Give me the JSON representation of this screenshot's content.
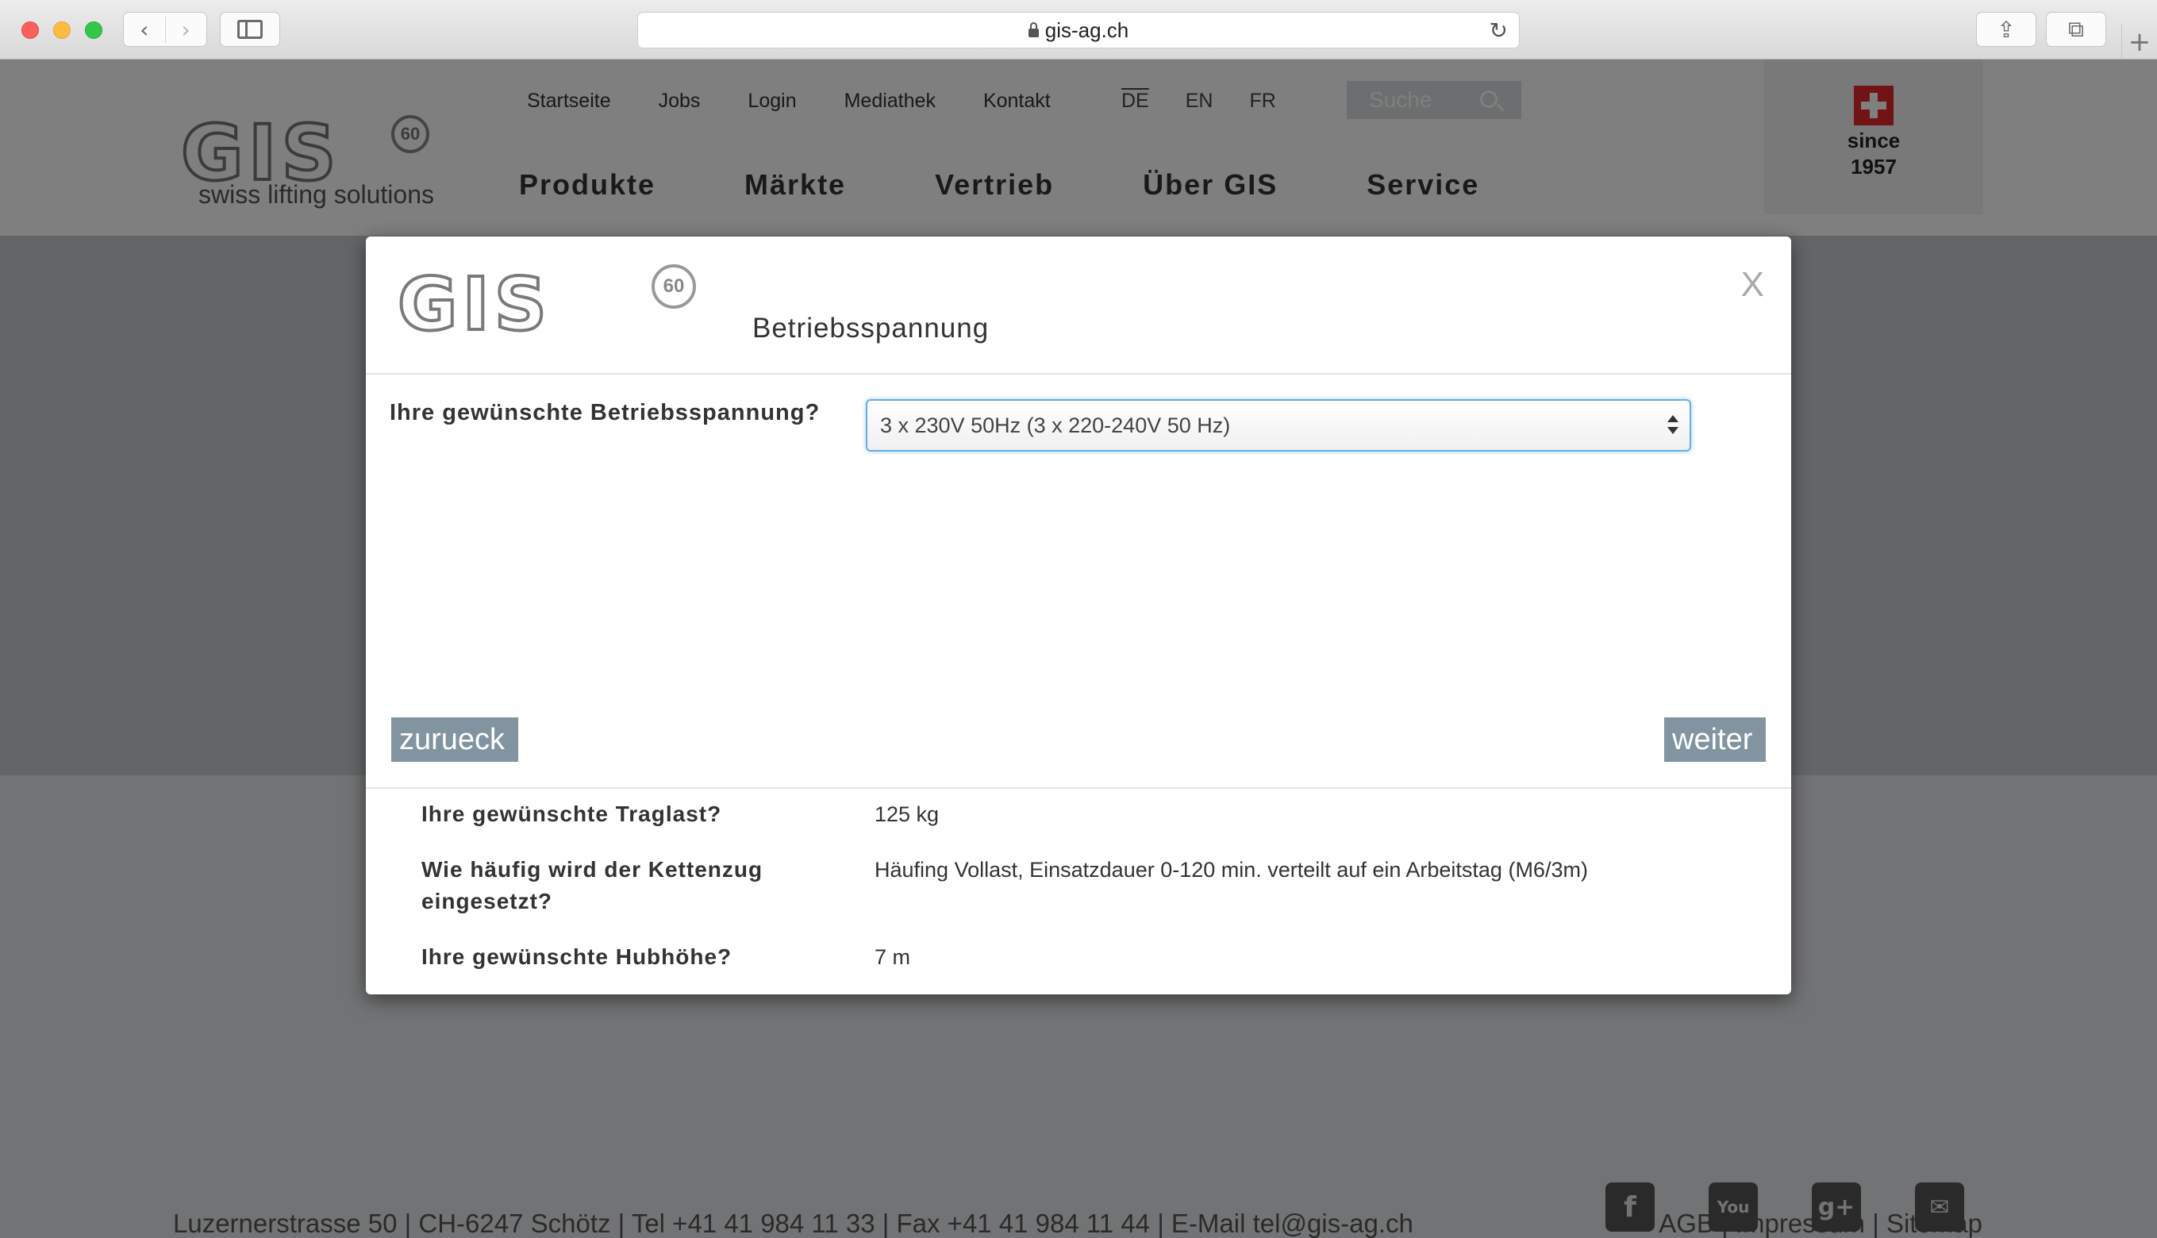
{
  "browser": {
    "url": "gis-ag.ch",
    "new_tab": "+"
  },
  "site": {
    "logo_text": "GIS",
    "logo_badge": "60",
    "tagline": "swiss lifting solutions",
    "topnav": [
      "Startseite",
      "Jobs",
      "Login",
      "Mediathek",
      "Kontakt"
    ],
    "languages": [
      "DE",
      "EN",
      "FR"
    ],
    "search_placeholder": "Suche",
    "mainnav": [
      "Produkte",
      "Märkte",
      "Vertrieb",
      "Über GIS",
      "Service"
    ],
    "since_label": "since",
    "since_year": "1957"
  },
  "footer": {
    "address": "Luzernerstrasse 50 | CH-6247 Schötz  |  Tel +41 41 984 11 33  |  Fax +41 41 984 11 44  |  E-Mail tel@gis-ag.ch",
    "links": "AGB | Impressum | Sitemap",
    "social_icons": [
      "facebook-icon",
      "youtube-icon",
      "google-plus-icon",
      "mail-icon"
    ]
  },
  "modal": {
    "logo_text": "GIS",
    "logo_badge": "60",
    "title": "Betriebsspannung",
    "close_label": "X",
    "question": "Ihre gewünschte Betriebsspannung?",
    "selected_option": "3 x 230V 50Hz (3 x 220-240V 50 Hz)",
    "back_label": "zurueck",
    "next_label": "weiter",
    "summary": [
      {
        "question": "Ihre gewünschte Traglast?",
        "answer": "125 kg"
      },
      {
        "question": "Wie häufig wird der Kettenzug eingesetzt?",
        "answer": "Häufing Vollast, Einsatzdauer 0-120 min. verteilt auf ein Arbeitstag (M6/3m)"
      },
      {
        "question": "Ihre gewünschte Hubhöhe?",
        "answer": "7 m"
      }
    ]
  }
}
